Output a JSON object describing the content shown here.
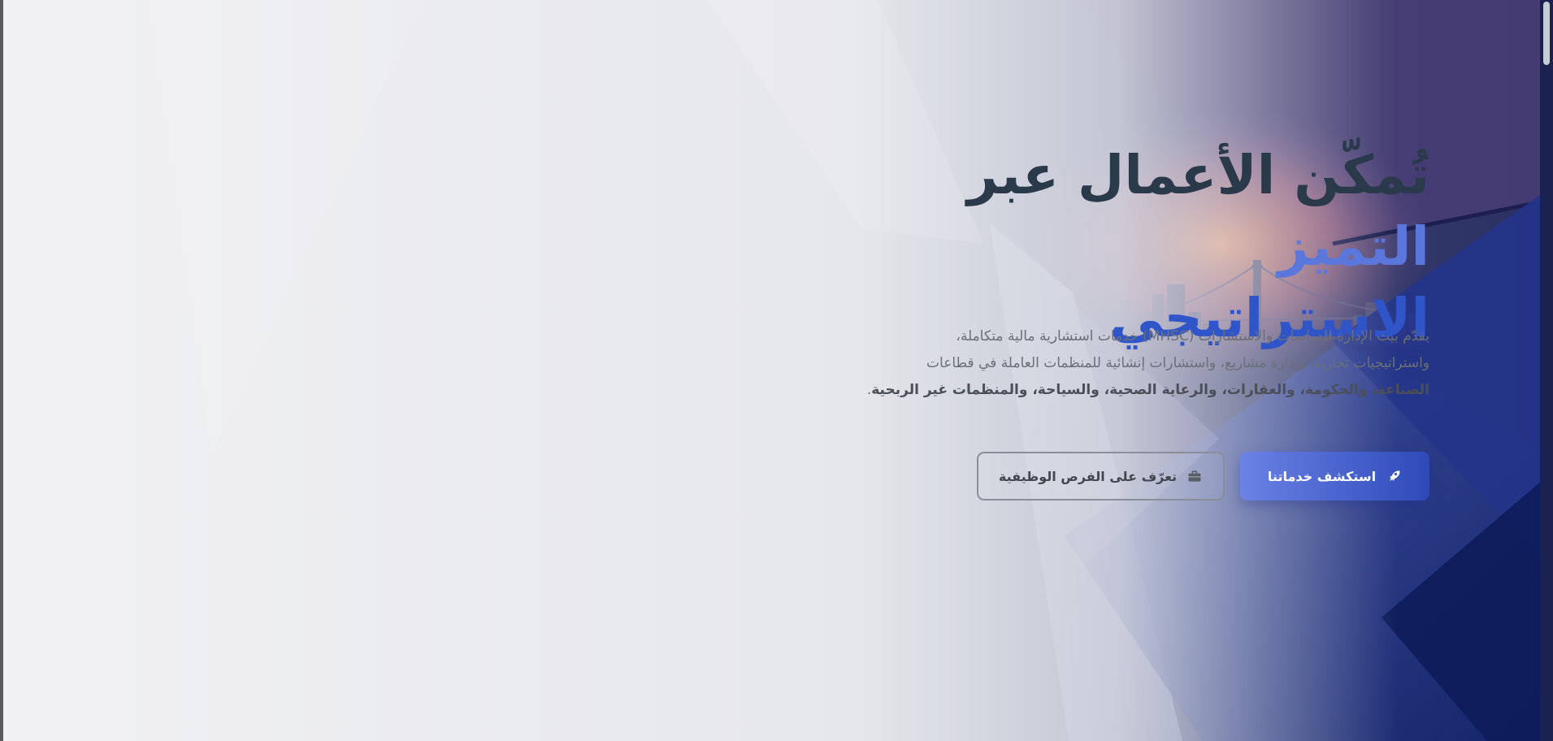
{
  "hero": {
    "headline_part1": "تُمكّن الأعمال عبر ",
    "headline_accent1": "التميز",
    "headline_accent2": "الاستراتيجي",
    "desc_line1": "يقدّم بيت الإدارة للدراسات والاستشارات (MHSC) خدمات استشارية مالية متكاملة،",
    "desc_line2": "واستراتيجيات تجارية، وإدارة مشاريع، واستشارات إنشائية للمنظمات العاملة في قطاعات",
    "desc_bold": "الصناعة، والحكومة، والعقارات، والرعاية الصحية، والسياحة، والمنظمات غير الربحية",
    "desc_end": "."
  },
  "buttons": {
    "primary_label": "استكشف خدماتنا",
    "primary_icon": "rocket-icon",
    "secondary_label": "تعرّف على الفرص الوظيفية",
    "secondary_icon": "briefcase-icon"
  },
  "colors": {
    "headline": "#2b3a4b",
    "accent_light": "#5b77dc",
    "accent_dark": "#2f55c8",
    "primary_button_start": "#6b82e6",
    "primary_button_end": "#2d4ab8"
  }
}
